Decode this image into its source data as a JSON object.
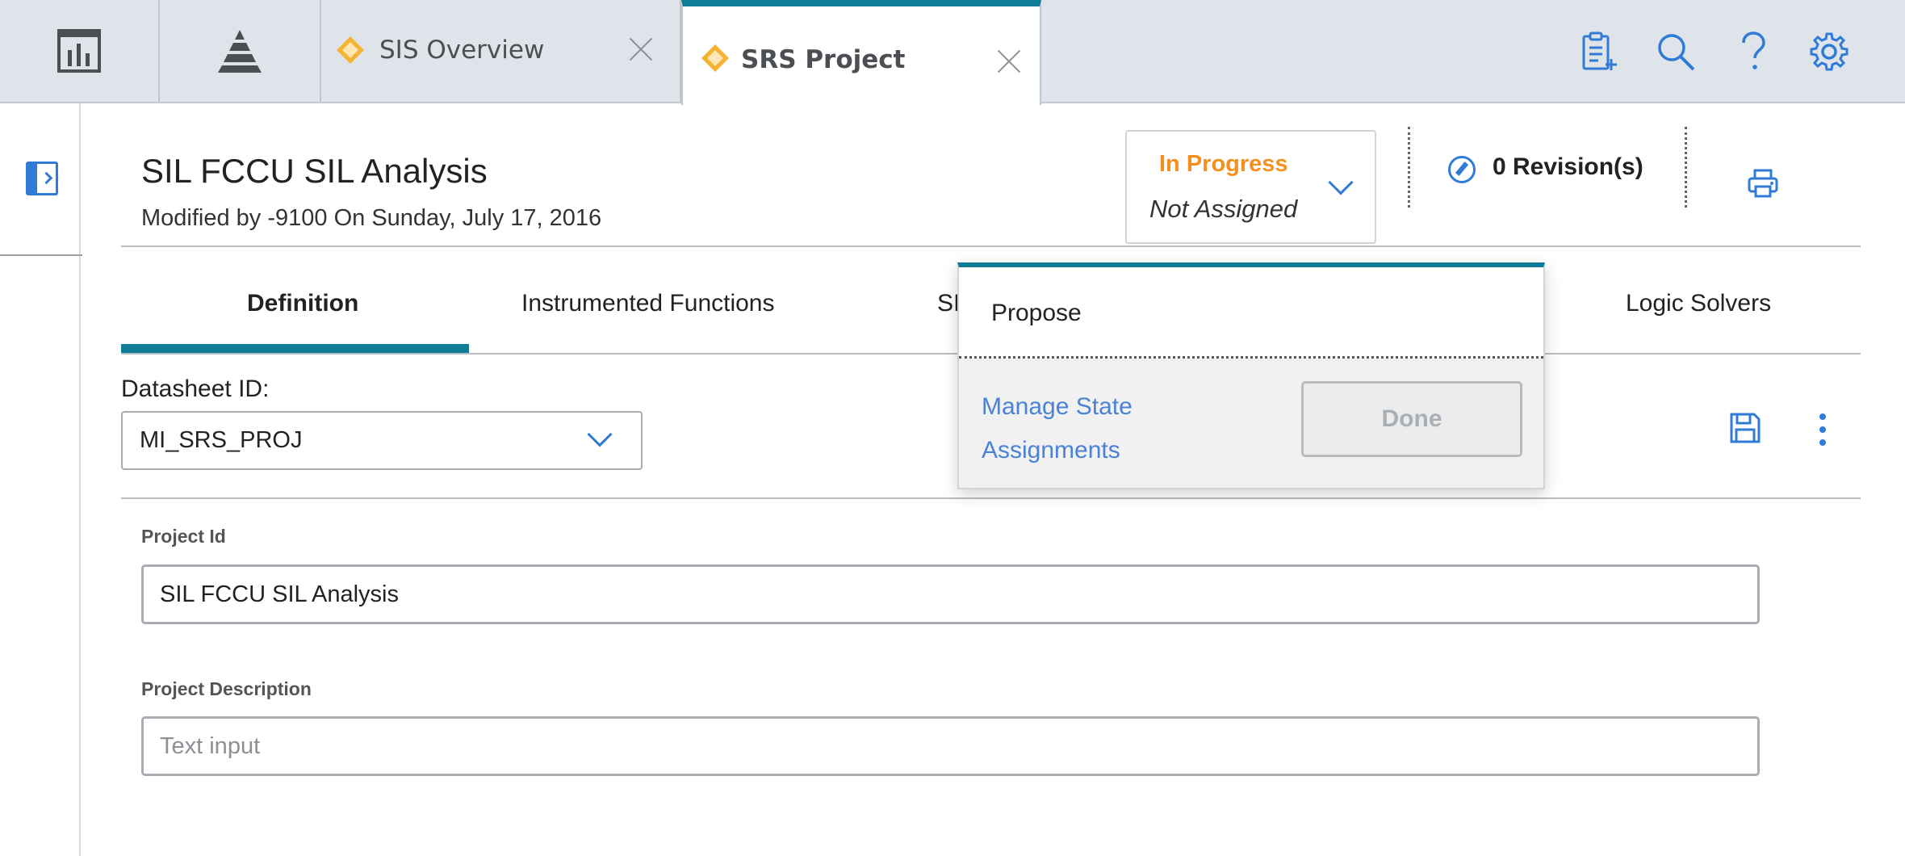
{
  "top_tabs": {
    "app_tabs": [
      {
        "icon": "dashboard-chart-icon"
      },
      {
        "icon": "pyramid-icon"
      }
    ],
    "documents": [
      {
        "label": "SIS Overview",
        "active": false,
        "icon": "diamond-icon"
      },
      {
        "label": "SRS Project",
        "active": true,
        "icon": "diamond-icon"
      }
    ],
    "toolbar_icons": [
      "clipboard-add-icon",
      "search-icon",
      "help-icon",
      "gear-icon"
    ]
  },
  "header": {
    "title": "SIL FCCU SIL Analysis",
    "modified": "Modified by -9100 On Sunday, July 17, 2016",
    "state": {
      "name": "In Progress",
      "assignee": "Not Assigned",
      "color": "#f3901f"
    },
    "revisions": "0 Revision(s)"
  },
  "tabs": [
    {
      "label": "Definition",
      "active": true
    },
    {
      "label": "Instrumented Functions",
      "active": false
    },
    {
      "label": "SI",
      "active": false
    },
    {
      "label": "Logic Solvers",
      "active": false
    }
  ],
  "datasheet": {
    "label": "Datasheet ID:",
    "value": "MI_SRS_PROJ"
  },
  "fields": {
    "project_id": {
      "label": "Project Id",
      "value": "SIL FCCU SIL Analysis"
    },
    "project_description": {
      "label": "Project Description",
      "value": "",
      "placeholder": "Text input"
    }
  },
  "state_popup": {
    "action": "Propose",
    "link_line1": "Manage State",
    "link_line2": "Assignments",
    "done_label": "Done"
  },
  "colors": {
    "accent_teal": "#0f7d95",
    "link_blue": "#2f7bd5",
    "state_orange": "#f3901f"
  }
}
